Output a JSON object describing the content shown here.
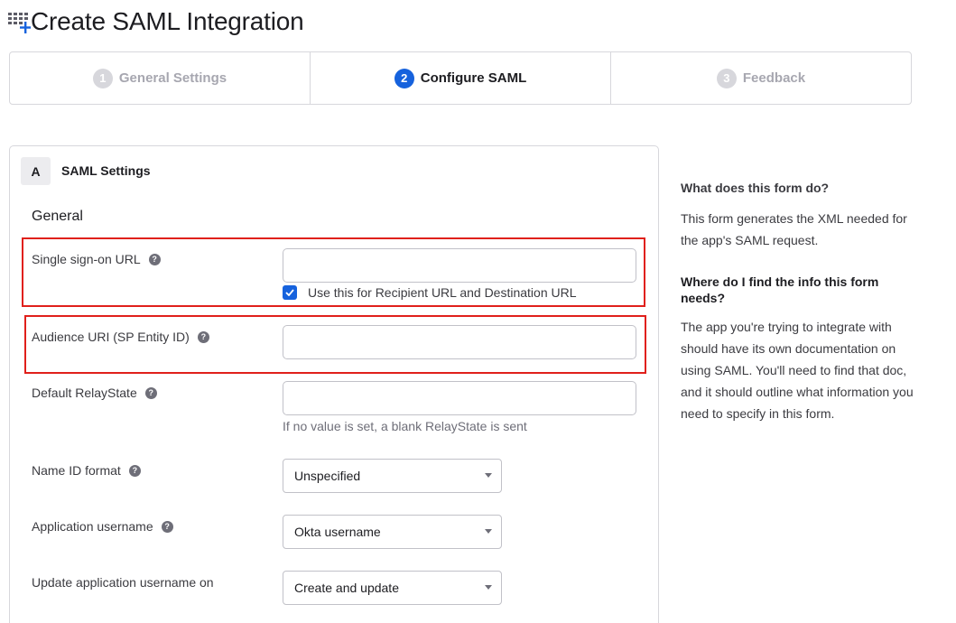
{
  "header": {
    "title": "Create SAML Integration",
    "icon": "app-grid-add-icon"
  },
  "steps": [
    {
      "number": "1",
      "label": "General Settings",
      "state": "inactive"
    },
    {
      "number": "2",
      "label": "Configure SAML",
      "state": "active"
    },
    {
      "number": "3",
      "label": "Feedback",
      "state": "inactive"
    }
  ],
  "section": {
    "badge": "A",
    "title": "SAML Settings",
    "group": "General"
  },
  "fields": {
    "sso_url": {
      "label": "Single sign-on URL",
      "value": "",
      "checkbox_label": "Use this for Recipient URL and Destination URL",
      "checkbox_checked": true
    },
    "audience_uri": {
      "label": "Audience URI (SP Entity ID)",
      "value": ""
    },
    "relay_state": {
      "label": "Default RelayState",
      "value": "",
      "hint": "If no value is set, a blank RelayState is sent"
    },
    "name_id_format": {
      "label": "Name ID format",
      "selected": "Unspecified"
    },
    "app_username": {
      "label": "Application username",
      "selected": "Okta username"
    },
    "update_username": {
      "label": "Update application username on",
      "selected": "Create and update"
    }
  },
  "help": {
    "q1": "What does this form do?",
    "a1": "This form generates the XML needed for the app's SAML request.",
    "q2": "Where do I find the info this form needs?",
    "a2": "The app you're trying to integrate with should have its own documentation on using SAML. You'll need to find that doc, and it should outline what information you need to specify in this form."
  },
  "colors": {
    "accent": "#1662dd",
    "highlight": "#e0201b",
    "step_inactive": "#d7d7dc"
  }
}
